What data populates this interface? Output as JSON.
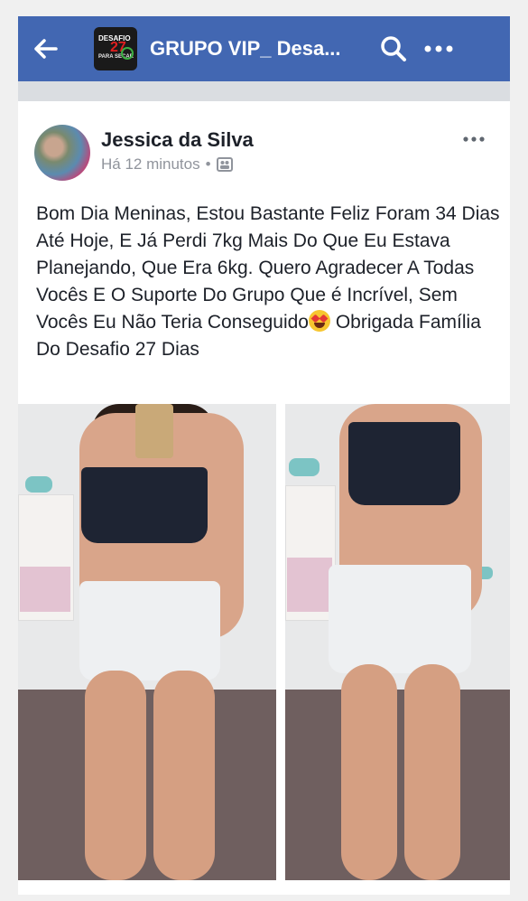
{
  "header": {
    "group_title": "GRUPO VIP_ Desa...",
    "group_thumb_line1": "DESAFIO",
    "group_thumb_number": "27",
    "group_thumb_line2": "DIAS",
    "group_thumb_line3": "PARA SECAR",
    "icons": [
      "back-arrow-icon",
      "search-icon",
      "more-icon"
    ],
    "bar_color": "#4267b2"
  },
  "post": {
    "author": "Jessica da Silva",
    "time": "Há 12 minutos",
    "separator": "•",
    "privacy_icon": "group-privacy-icon",
    "menu_icon": "more-icon",
    "text_before_emoji": "Bom Dia Meninas, Estou Bastante Feliz Foram 34 Dias Até Hoje, E Já Perdi 7kg Mais Do Que Eu Estava Planejando, Que Era 6kg. Quero Agradecer A Todas Vocês E O Suporte Do Grupo Que é Incrível, Sem Vocês Eu Não Teria Conseguido",
    "emoji": "heart-eyes-emoji",
    "text_after_emoji": " Obrigada Família Do Desafio 27 Dias",
    "photos": [
      "before-photo",
      "after-photo"
    ]
  }
}
